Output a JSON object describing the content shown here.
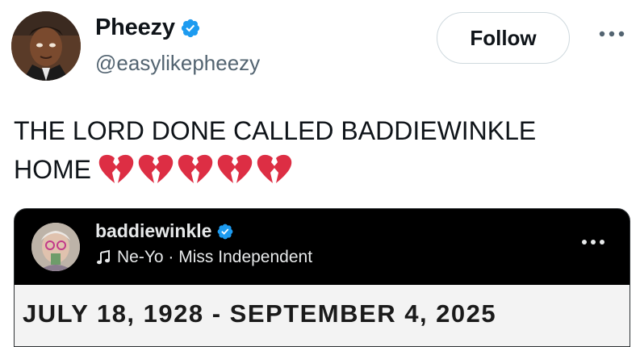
{
  "author": {
    "display_name": "Pheezy",
    "handle": "@easylikepheezy",
    "verified": true
  },
  "follow_label": "Follow",
  "tweet": {
    "text": "THE LORD DONE CALLED BADDIEWINKLE HOME",
    "emoji_icon": "broken-heart-icon",
    "emoji_count": 5
  },
  "embed": {
    "username": "baddiewinkle",
    "verified": true,
    "audio": "Ne-Yo · Miss Independent",
    "banner_text": "JULY 18, 1928 - SEPTEMBER 4, 2025"
  },
  "colors": {
    "verified_blue": "#1d9bf0",
    "heart_red": "#dd2e44",
    "secondary_text": "#536471",
    "follow_border": "#cfd9de"
  }
}
